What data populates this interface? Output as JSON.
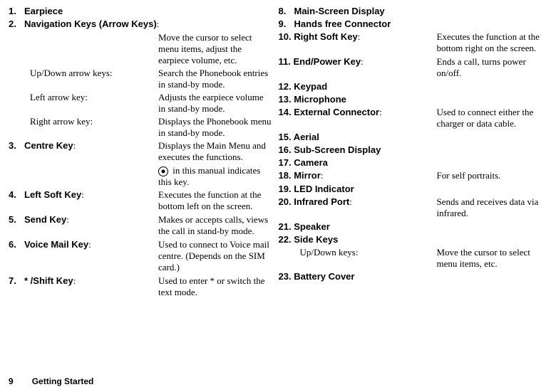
{
  "footer": {
    "page": "9",
    "section": "Getting Started"
  },
  "left": {
    "i1": {
      "n": "1.",
      "t": "Earpiece"
    },
    "i2": {
      "n": "2.",
      "t": "Navigation Keys (Arrow Keys)",
      "colon": ":"
    },
    "i2d": "Move the cursor to select menu items, adjust the earpiece volume, etc.",
    "i2a": {
      "l": "Up/Down arrow keys:",
      "d": "Search the Phonebook entries in stand-by mode."
    },
    "i2b": {
      "l": "Left arrow key:",
      "d": "Adjusts the earpiece volume in stand-by mode."
    },
    "i2c": {
      "l": "Right arrow key:",
      "d": "Displays the Phonebook menu in stand-by mode."
    },
    "i3": {
      "n": "3.",
      "t": "Centre Key",
      "colon": ":",
      "d": "Displays the Main Menu and executes the functions."
    },
    "i3b": " in this manual indicates this key.",
    "i4": {
      "n": "4.",
      "t": "Left Soft Key",
      "colon": ":",
      "d": "Executes the function at the bottom left on the screen."
    },
    "i5": {
      "n": "5.",
      "t": "Send Key",
      "colon": ":",
      "d": "Makes or accepts calls, views the call in stand-by mode."
    },
    "i6": {
      "n": "6.",
      "t": "Voice Mail Key",
      "colon": ":",
      "d": "Used to connect to Voice mail centre. (Depends on the SIM card.)"
    },
    "i7": {
      "n": "7.",
      "t": "* /Shift Key",
      "colon": ":",
      "d": "Used to enter * or switch the text mode."
    }
  },
  "right": {
    "i8": {
      "n": "8.",
      "t": "Main-Screen Display"
    },
    "i9": {
      "n": "9.",
      "t": "Hands free Connector"
    },
    "i10": {
      "n": "10.",
      "t": "Right Soft Key",
      "colon": ":",
      "d": "Executes the function at the bottom right on the screen."
    },
    "i11": {
      "n": "11.",
      "t": "End/Power Key",
      "colon": ":",
      "d": "Ends a call, turns power on/off."
    },
    "i12": {
      "n": "12.",
      "t": "Keypad"
    },
    "i13": {
      "n": "13.",
      "t": "Microphone"
    },
    "i14": {
      "n": "14.",
      "t": "External Connector",
      "colon": ":",
      "d": "Used to connect either the charger or data cable."
    },
    "i15": {
      "n": "15.",
      "t": "Aerial"
    },
    "i16": {
      "n": "16.",
      "t": "Sub-Screen Display"
    },
    "i17": {
      "n": "17.",
      "t": "Camera"
    },
    "i18": {
      "n": "18.",
      "t": "Mirror",
      "colon": ":",
      "d": "For self portraits."
    },
    "i19": {
      "n": "19.",
      "t": "LED Indicator"
    },
    "i20": {
      "n": "20.",
      "t": "Infrared Port",
      "colon": ":",
      "d": "Sends and receives data via infrared."
    },
    "i21": {
      "n": "21.",
      "t": "Speaker"
    },
    "i22": {
      "n": "22.",
      "t": "Side Keys"
    },
    "i22a": {
      "l": "Up/Down keys:",
      "d": "Move the cursor to select menu items, etc."
    },
    "i23": {
      "n": "23.",
      "t": "Battery Cover"
    }
  }
}
